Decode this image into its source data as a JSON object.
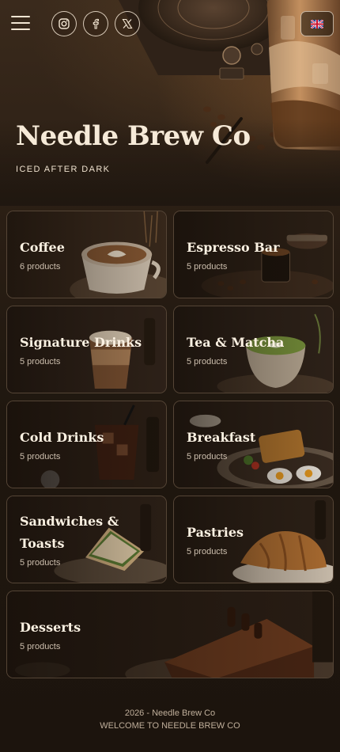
{
  "header": {
    "title": "Needle Brew Co",
    "subtitle": "ICED AFTER DARK",
    "social": [
      {
        "name": "instagram-icon"
      },
      {
        "name": "facebook-icon"
      },
      {
        "name": "x-twitter-icon"
      }
    ],
    "language": "uk-flag-icon"
  },
  "categories": [
    {
      "name": "Coffee",
      "count": "6 products",
      "theme": "coffee"
    },
    {
      "name": "Espresso Bar",
      "count": "5 products",
      "theme": "espresso"
    },
    {
      "name": "Signature Drinks",
      "count": "5 products",
      "theme": "signature"
    },
    {
      "name": "Tea & Matcha",
      "count": "5 products",
      "theme": "matcha"
    },
    {
      "name": "Cold Drinks",
      "count": "5 products",
      "theme": "cold"
    },
    {
      "name": "Breakfast",
      "count": "5 products",
      "theme": "breakfast"
    },
    {
      "name": "Sandwiches & Toasts",
      "count": "5 products",
      "theme": "sandwich"
    },
    {
      "name": "Pastries",
      "count": "5 products",
      "theme": "pastry"
    },
    {
      "name": "Desserts",
      "count": "5 products",
      "theme": "dessert"
    }
  ],
  "footer": {
    "line1": "2026 - Needle Brew Co",
    "line2": "WELCOME TO NEEDLE BREW CO"
  },
  "colors": {
    "background": "#1e160f",
    "text": "#f3e6d3",
    "accent": "#c98a4b"
  }
}
